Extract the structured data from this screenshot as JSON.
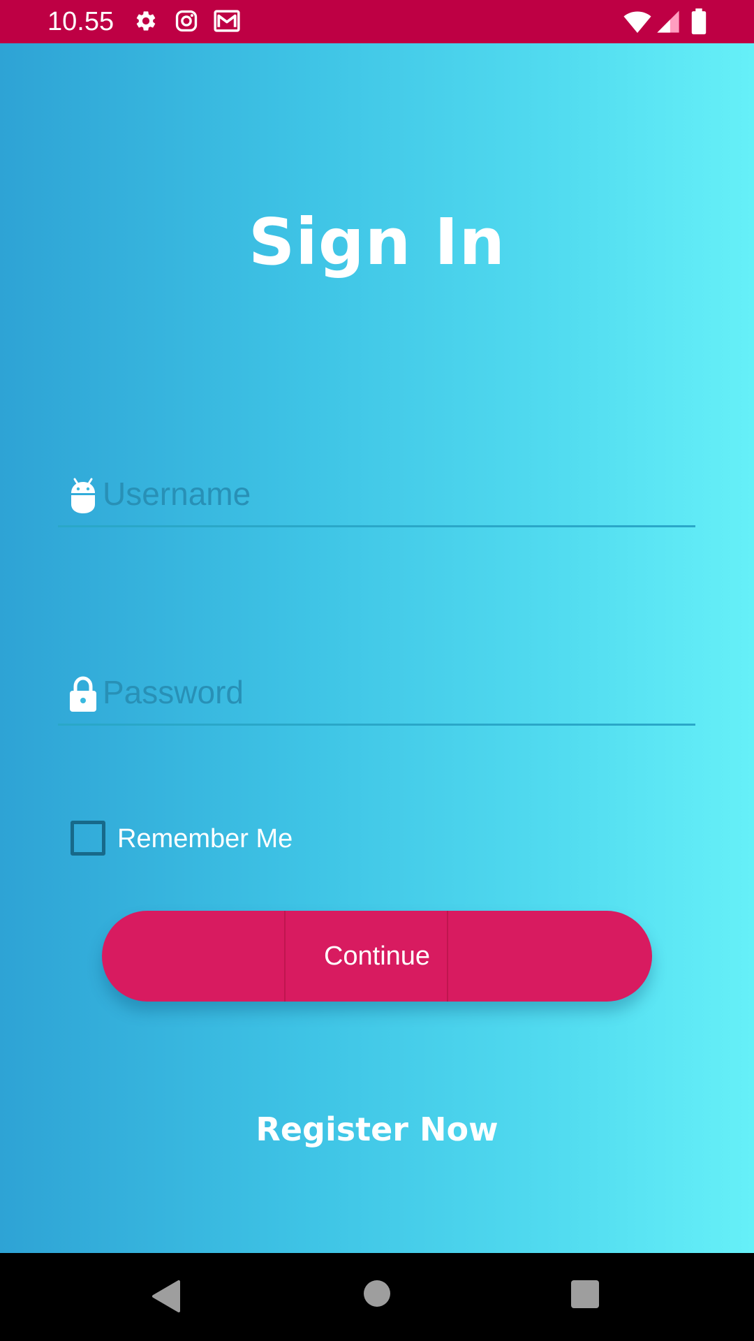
{
  "status_bar": {
    "time": "10.55",
    "left_icons": [
      "gear-icon",
      "instagram-icon",
      "gmail-icon"
    ],
    "right_icons": [
      "wifi-icon",
      "signal-icon",
      "battery-icon"
    ],
    "background": "#be0044"
  },
  "screen": {
    "title": "Sign In",
    "gradient": [
      "#2ea3d5",
      "#66f0f8"
    ]
  },
  "form": {
    "username": {
      "icon": "android-icon",
      "placeholder": "Username",
      "value": ""
    },
    "password": {
      "icon": "lock-icon",
      "placeholder": "Password",
      "value": ""
    },
    "remember_me": {
      "label": "Remember Me",
      "checked": false
    },
    "continue_label": "Continue",
    "continue_color": "#d81b60",
    "register_label": "Register Now"
  },
  "nav_bar": {
    "buttons": [
      "back-icon",
      "home-icon",
      "recents-icon"
    ]
  }
}
